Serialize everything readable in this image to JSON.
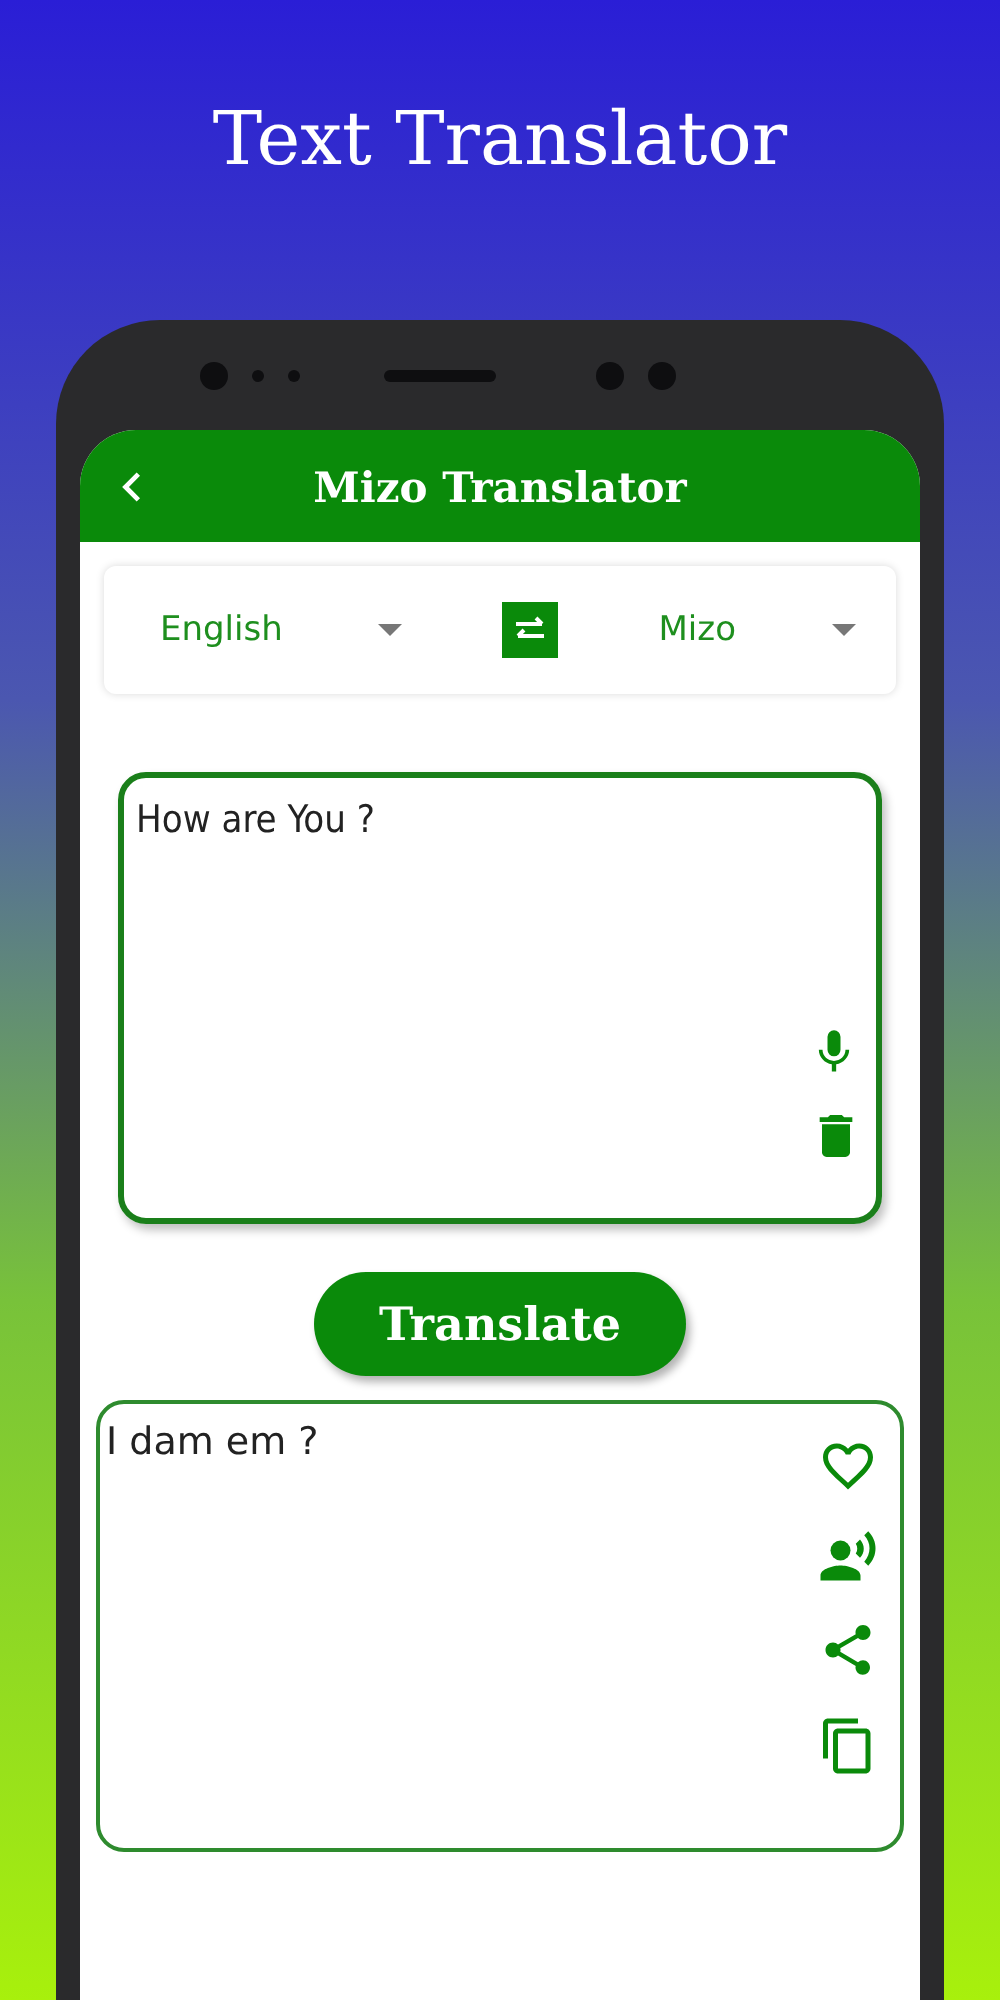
{
  "title": "Text Translator",
  "app_bar": {
    "title": "Mizo Translator"
  },
  "languages": {
    "source": "English",
    "target": "Mizo"
  },
  "input": {
    "value": "How are You ?"
  },
  "translate_button": "Translate",
  "output": {
    "text": "I dam em ?"
  }
}
